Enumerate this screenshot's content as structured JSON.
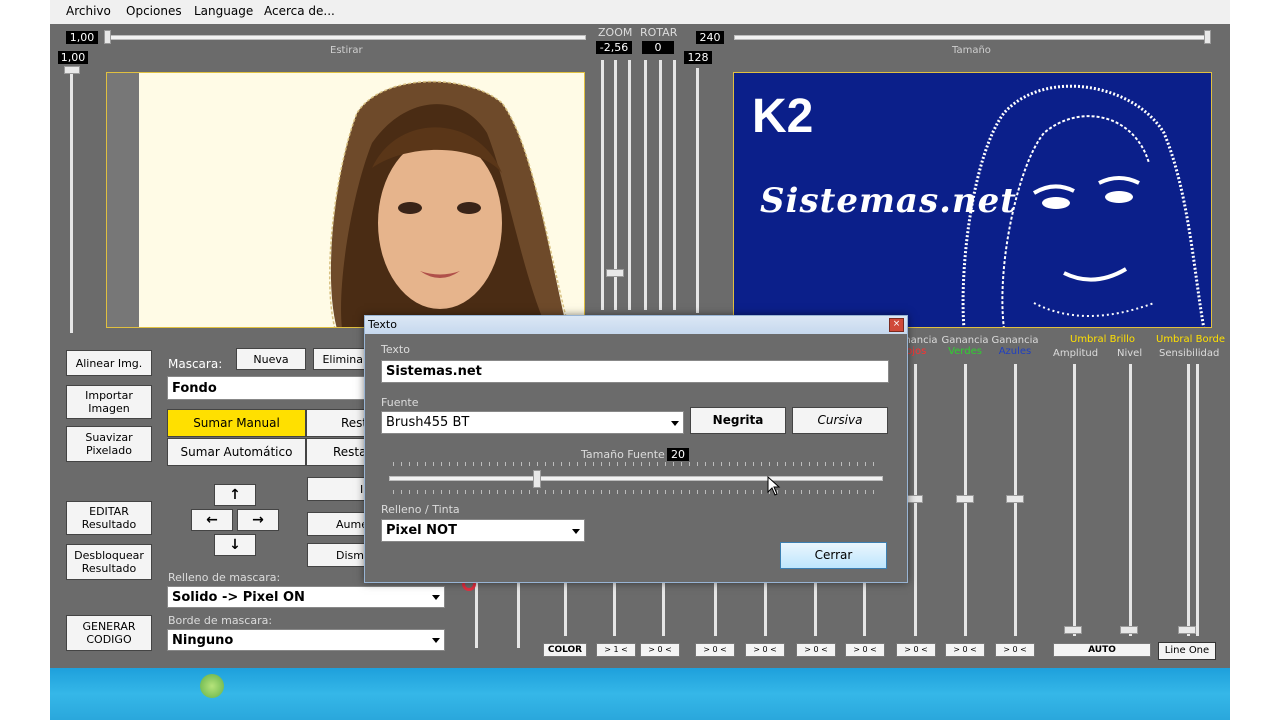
{
  "menu": [
    "Archivo",
    "Opciones",
    "Language",
    "Acerca de..."
  ],
  "top": {
    "estirar_value": "1,00",
    "estirar_label": "Estirar",
    "vertical_value": "1,00",
    "zoom_label": "ZOOM",
    "zoom_value": "-2,56",
    "rotar_label": "ROTAR",
    "rotar_value": "0",
    "tamano_value": "240",
    "tamano_sub_value": "128",
    "tamano_label": "Tamaño"
  },
  "preview": {
    "logo_text": "K2",
    "brand_text": "Sistemas.net"
  },
  "left_panel": {
    "buttons": [
      "Alinear Img.",
      "Importar Imagen",
      "Suavizar Pixelado",
      "EDITAR Resultado",
      "Desbloquear Resultado",
      "GENERAR CODIGO"
    ],
    "mascara_label": "Mascara:",
    "nueva_label": "Nueva",
    "eliminar_label": "Eliminar",
    "mascara_value": "Fondo",
    "sumar_manual": "Sumar Manual",
    "sumar_auto": "Sumar Automático",
    "restar_manual": "Restar Manual",
    "restar_auto": "Restar Automático",
    "mid_btns": [
      "Invertir",
      "Aumentar",
      "Disminuir"
    ],
    "arrows": [
      "↑",
      "←",
      "→",
      "↓"
    ],
    "relleno_label": "Relleno de mascara:",
    "relleno_value": "Solido -> Pixel ON",
    "borde_label": "Borde de mascara:",
    "borde_value": "Ninguno"
  },
  "right_panel": {
    "gain_headers": [
      {
        "top": "Ganancia",
        "bottom": "Rojos",
        "color": "#ff3030"
      },
      {
        "top": "Ganancia",
        "bottom": "Verdes",
        "color": "#30d030"
      },
      {
        "top": "Ganancia",
        "bottom": "Azules",
        "color": "#2040c0"
      }
    ],
    "umbral_brillo": "Umbral Brillo",
    "umbral_borde": "Umbral Borde",
    "amplitud": "Amplitud",
    "nivel": "Nivel",
    "sensibilidad": "Sensibilidad",
    "auto_label": "AUTO",
    "lineone_label": "Line One"
  },
  "bottom_buttons": {
    "color_label": "COLOR",
    "first_label": "> 1 <",
    "zero_label": "> 0 <"
  },
  "dialog": {
    "title": "Texto",
    "texto_label": "Texto",
    "texto_value": "Sistemas.net",
    "fuente_label": "Fuente",
    "fuente_value": "Brush455 BT",
    "negrita_label": "Negrita",
    "cursiva_label": "Cursiva",
    "tamano_label": "Tamaño Fuente",
    "tamano_value": "20",
    "tamano_level": 0.3,
    "relleno_label": "Relleno / Tinta",
    "relleno_value": "Pixel NOT",
    "cerrar_label": "Cerrar"
  }
}
